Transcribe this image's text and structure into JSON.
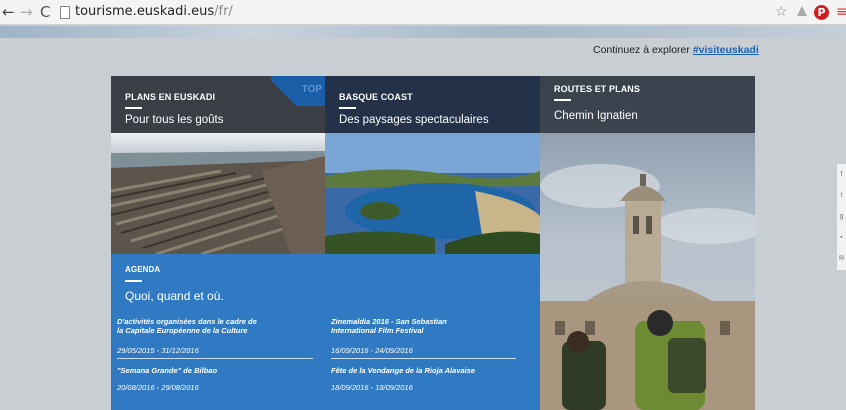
{
  "browser": {
    "url_host": "tourisme.euskadi.eus",
    "url_path": "/fr/",
    "back_icon": "←",
    "forward_icon": "→",
    "reload_icon": "C",
    "star_icon": "☆",
    "menu_icon": "≡",
    "pinterest_icon": "P"
  },
  "header": {
    "explore_text": "Continuez à explorer ",
    "explore_link": "#visiteuskadi"
  },
  "tiles": [
    {
      "kicker": "PLANS EN EUSKADI",
      "badge": "TOP",
      "subtitle": "Pour tous les goûts"
    },
    {
      "kicker": "BASQUE COAST",
      "subtitle": "Des paysages spectaculaires"
    },
    {
      "kicker": "ROUTES ET PLANS",
      "subtitle": "Chemin Ignatien"
    }
  ],
  "agenda": {
    "kicker": "AGENDA",
    "subtitle": "Quoi, quand et où.",
    "events": [
      {
        "title_line1": "D'activités organisées dans le cadre de",
        "title_line2": "la Capitale Européenne de la Culture",
        "dates": "29/05/2015 - 31/12/2016"
      },
      {
        "title_line1": "Zinemaldia 2016 - San Sebastian",
        "title_line2": "International Film Festival",
        "dates": "16/09/2016 - 24/09/2016"
      },
      {
        "title_line1": "\"Semana Grande\" de Bilbao",
        "title_line2": "",
        "dates": "20/08/2016 - 29/08/2016"
      },
      {
        "title_line1": "Fête de la Vendange de la Rioja Alavaise",
        "title_line2": "",
        "dates": "18/09/2016 - 18/09/2016"
      }
    ]
  },
  "social": [
    "f",
    "t",
    "g",
    "▪",
    "✉"
  ]
}
